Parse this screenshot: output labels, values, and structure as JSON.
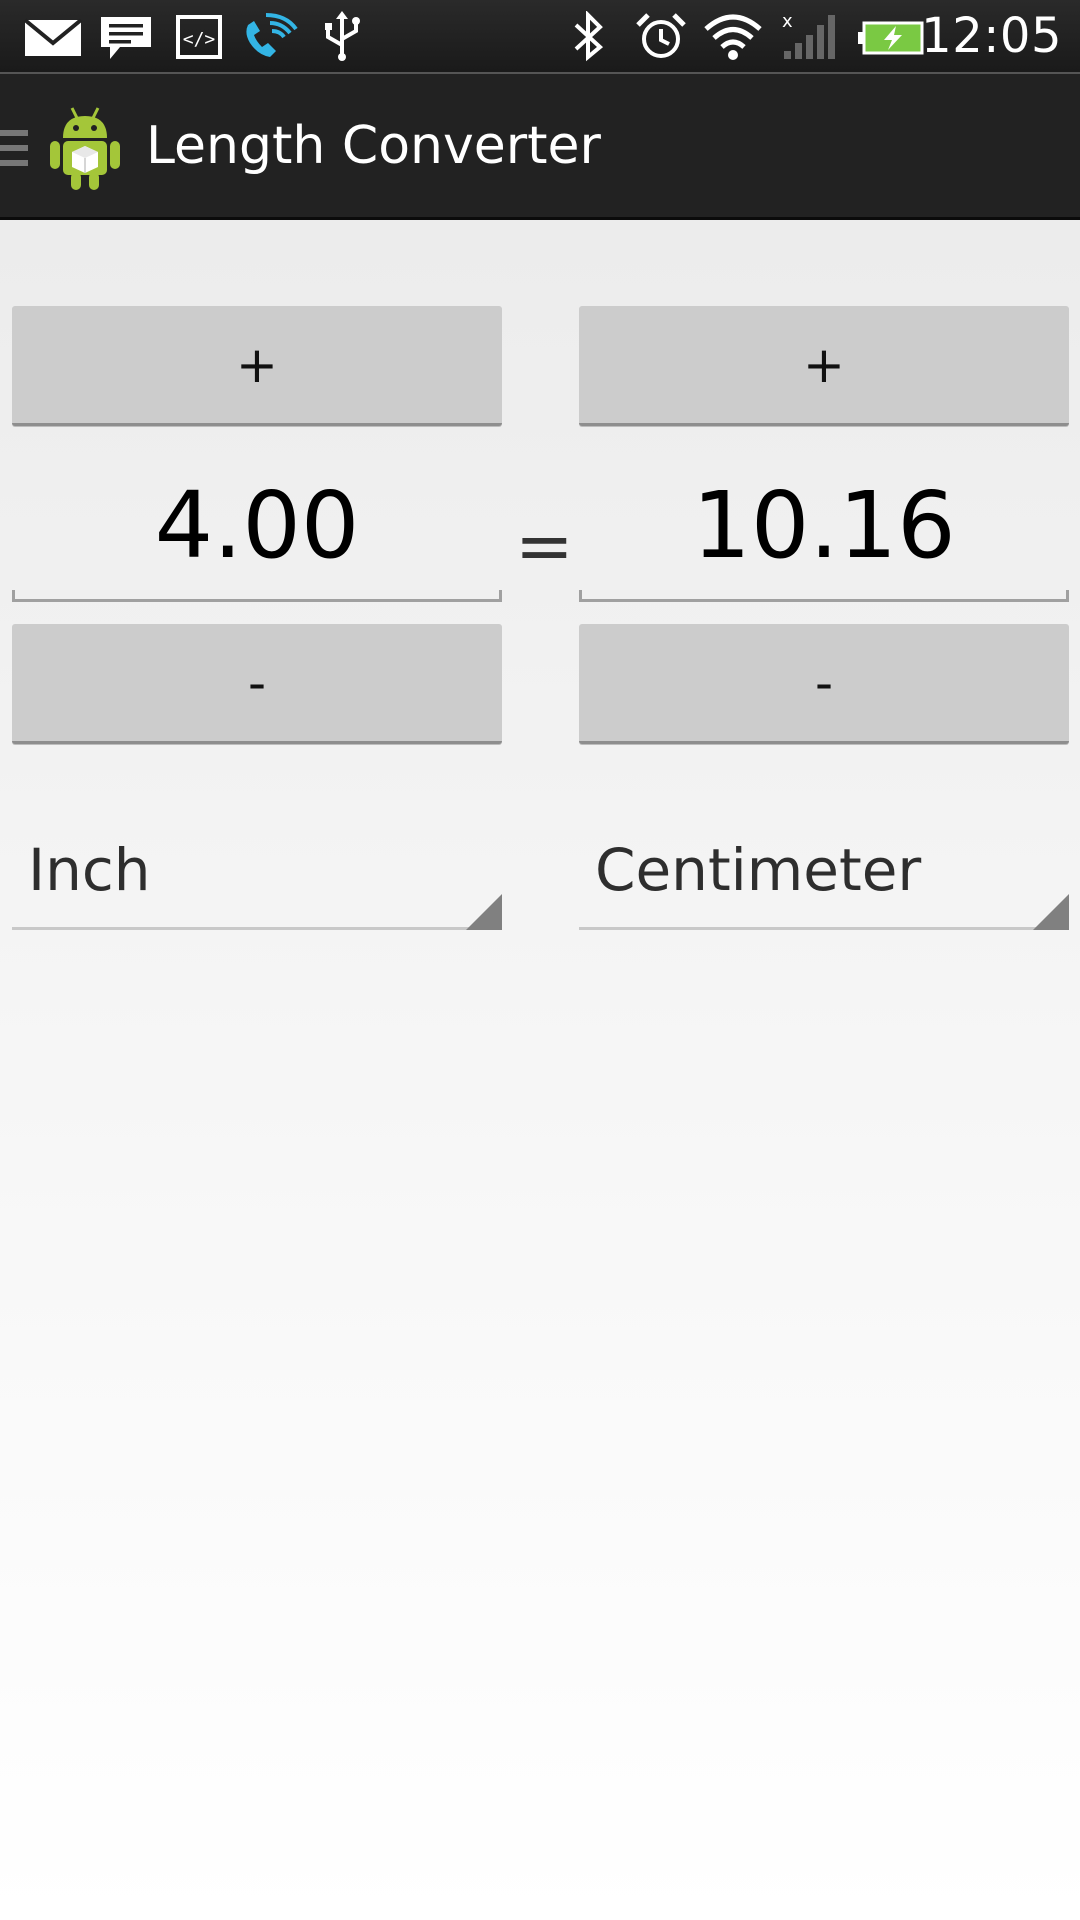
{
  "status_bar": {
    "time": "12:05",
    "left_icons": [
      "mail-icon",
      "message-icon",
      "code-icon",
      "wifi-call-icon",
      "usb-icon"
    ],
    "right_icons": [
      "bluetooth-icon",
      "alarm-icon",
      "wifi-icon",
      "signal-icon",
      "battery-icon"
    ]
  },
  "action_bar": {
    "title": "Length Converter",
    "icon": "android-app-icon"
  },
  "converter": {
    "left": {
      "plus_label": "+",
      "value": "4.00",
      "minus_label": "-",
      "unit": "Inch"
    },
    "equals": "=",
    "right": {
      "plus_label": "+",
      "value": "10.16",
      "minus_label": "-",
      "unit": "Centimeter"
    }
  },
  "colors": {
    "action_bar_bg": "#222222",
    "button_bg": "#cccccc",
    "battery_green": "#7ac943",
    "wifi_call_blue": "#33b5e5",
    "android_green": "#a4c639"
  }
}
